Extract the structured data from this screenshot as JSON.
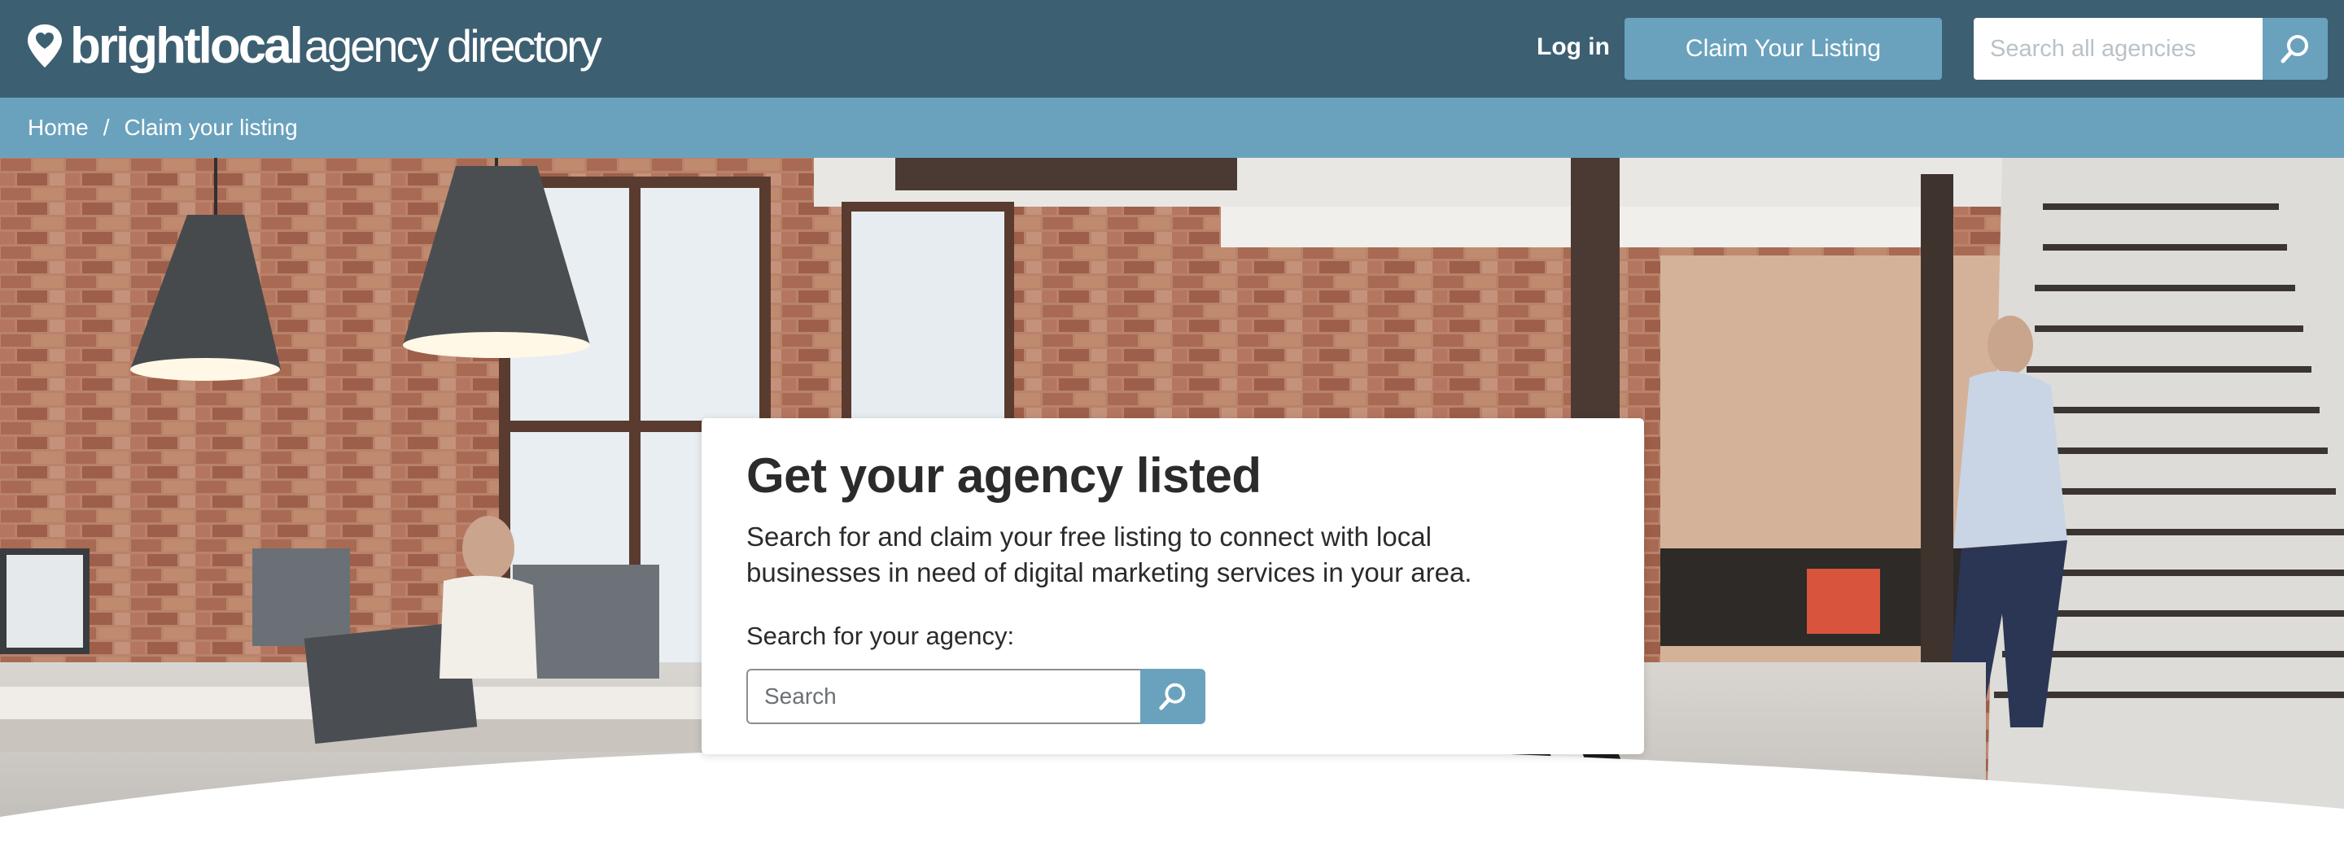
{
  "brand": {
    "logo_bold": "brightlocal",
    "logo_light": "agency directory",
    "logo_icon": "map-pin-heart-icon",
    "primary_color": "#3d5f72",
    "accent_color": "#6aa2bd"
  },
  "header": {
    "login_label": "Log in",
    "claim_label": "Claim Your Listing",
    "search_placeholder": "Search all agencies",
    "search_icon": "search-icon"
  },
  "breadcrumb": {
    "items": [
      "Home",
      "Claim your listing"
    ],
    "separator": "/"
  },
  "hero": {
    "background": "office-photo",
    "card": {
      "title": "Get your agency listed",
      "description": "Search for and claim your free listing to connect with local businesses in need of digital marketing services in your area.",
      "search_label": "Search for your agency:",
      "search_placeholder": "Search",
      "search_icon": "search-icon"
    }
  }
}
